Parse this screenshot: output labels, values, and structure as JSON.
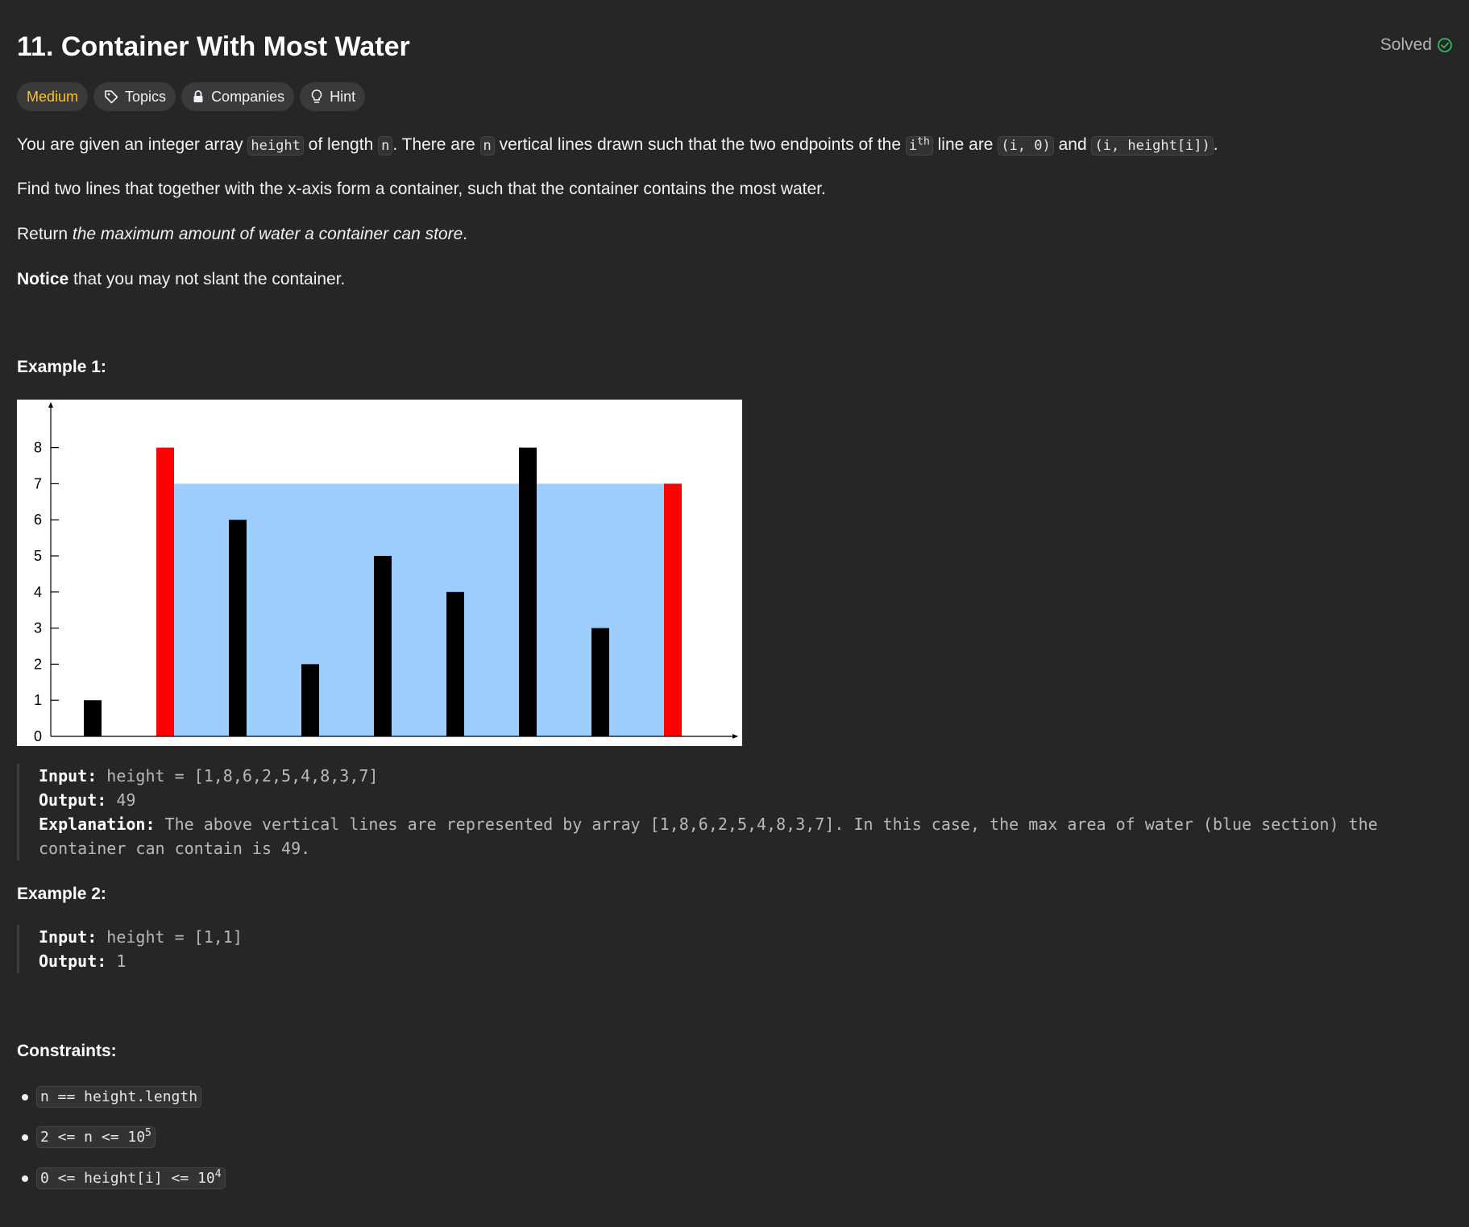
{
  "header": {
    "title": "11. Container With Most Water",
    "solved_label": "Solved"
  },
  "tags": {
    "difficulty": "Medium",
    "topics": "Topics",
    "companies": "Companies",
    "hint": "Hint"
  },
  "description": {
    "p1": {
      "t1": "You are given an integer array ",
      "c1": "height",
      "t2": " of length ",
      "c2": "n",
      "t3": ". There are ",
      "c3": "n",
      "t4": " vertical lines drawn such that the two endpoints of the ",
      "c4": "i",
      "sup": "th",
      "t5": " line are ",
      "c5": "(i, 0)",
      "t6": " and ",
      "c6": "(i, height[i])",
      "t7": "."
    },
    "p2": "Find two lines that together with the x-axis form a container, such that the container contains the most water.",
    "p3": {
      "t1": "Return ",
      "em": "the maximum amount of water a container can store",
      "t2": "."
    },
    "p4": {
      "bold": "Notice",
      "t1": " that you may not slant the container."
    }
  },
  "example1": {
    "heading": "Example 1:",
    "input_label": "Input:",
    "input_value": "height = [1,8,6,2,5,4,8,3,7]",
    "output_label": "Output:",
    "output_value": "49",
    "explanation_label": "Explanation:",
    "explanation_line1": "The above vertical lines are represented by array [1,8,6,2,5,4,8,3,7]. In this case, the max area of water (blue section) the",
    "explanation_line2": "container can contain is 49."
  },
  "example2": {
    "heading": "Example 2:",
    "input_label": "Input:",
    "input_value": "height = [1,1]",
    "output_label": "Output:",
    "output_value": "1"
  },
  "constraints": {
    "heading": "Constraints:",
    "items": [
      {
        "text": "n == height.length",
        "sup": ""
      },
      {
        "text": "2 <= n <= 10",
        "sup": "5"
      },
      {
        "text": "0 <= height[i] <= 10",
        "sup": "4"
      }
    ]
  },
  "chart_data": {
    "type": "bar",
    "categories": [
      "0",
      "1",
      "2",
      "3",
      "4",
      "5",
      "6",
      "7",
      "8"
    ],
    "values": [
      1,
      8,
      6,
      2,
      5,
      4,
      8,
      3,
      7
    ],
    "highlight_indices": [
      1,
      8
    ],
    "water_level": 7,
    "water_range": [
      1,
      8
    ],
    "title": "",
    "xlabel": "",
    "ylabel": "",
    "yticks": [
      0,
      1,
      2,
      3,
      4,
      5,
      6,
      7,
      8
    ],
    "ylim": [
      0,
      8.3
    ],
    "colors": {
      "bar": "#000000",
      "highlight": "#ff0000",
      "water": "#9dcdfd"
    }
  },
  "colors": {
    "background": "#262626",
    "difficulty": "#ffc01e",
    "solved_check": "#2cbb5d"
  }
}
